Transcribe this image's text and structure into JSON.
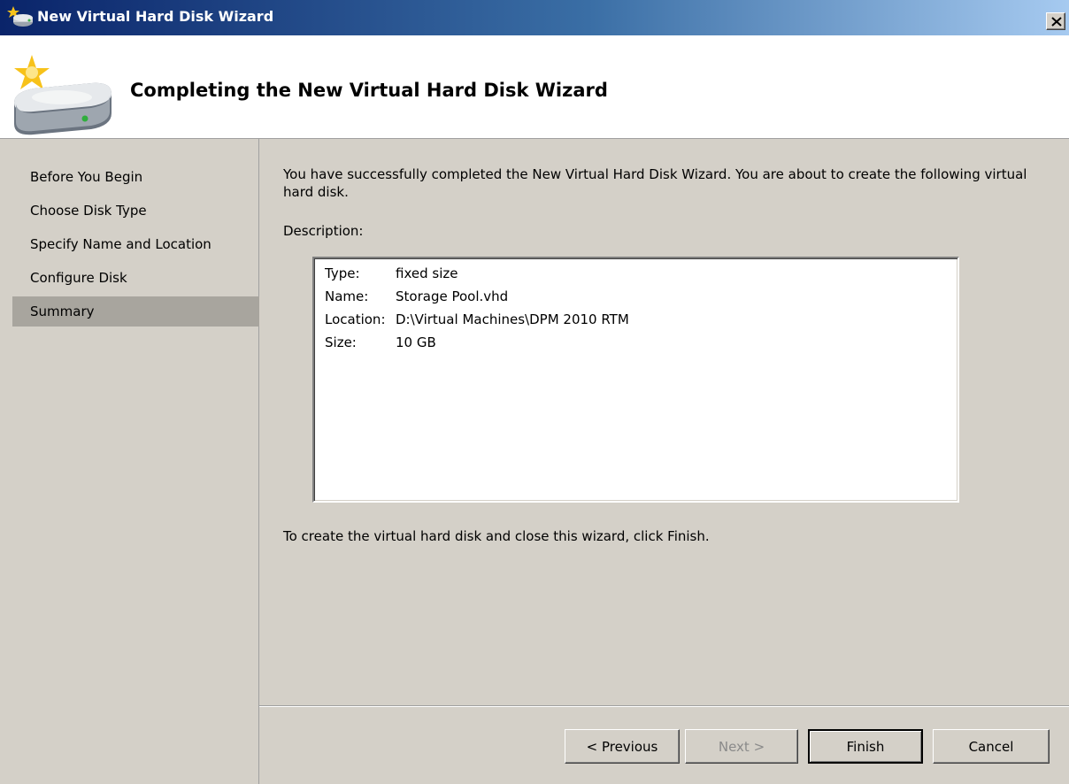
{
  "window": {
    "title": "New Virtual Hard Disk Wizard"
  },
  "header": {
    "title": "Completing the New Virtual Hard Disk Wizard"
  },
  "nav": {
    "items": [
      {
        "label": "Before You Begin",
        "selected": false
      },
      {
        "label": "Choose Disk Type",
        "selected": false
      },
      {
        "label": "Specify Name and Location",
        "selected": false
      },
      {
        "label": "Configure Disk",
        "selected": false
      },
      {
        "label": "Summary",
        "selected": true
      }
    ]
  },
  "content": {
    "intro": "You have successfully completed the New Virtual Hard Disk Wizard. You are about to create the following virtual hard disk.",
    "description_label": "Description:",
    "summary": [
      {
        "key": "Type:",
        "value": "fixed size"
      },
      {
        "key": "Name:",
        "value": "Storage Pool.vhd"
      },
      {
        "key": "Location:",
        "value": "D:\\Virtual Machines\\DPM 2010 RTM"
      },
      {
        "key": "Size:",
        "value": "10 GB"
      }
    ],
    "finish_hint": "To create the virtual hard disk and close this wizard, click Finish."
  },
  "buttons": {
    "previous": "< Previous",
    "next": "Next >",
    "finish": "Finish",
    "cancel": "Cancel"
  },
  "icons": {
    "title_icon": "new-disk-icon",
    "header_icon": "hard-disk-sparkle-icon",
    "close_icon": "close-icon"
  },
  "colors": {
    "titlebar_start": "#0a246a",
    "titlebar_end": "#a6caf0",
    "nav_selected": "#a8a59e",
    "dialog_bg": "#d4d0c8"
  }
}
